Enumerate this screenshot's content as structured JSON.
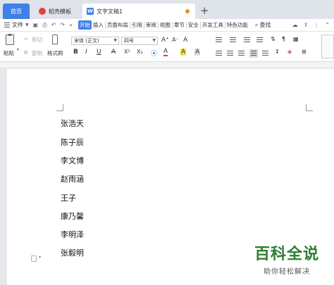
{
  "tabs": {
    "home": "首页",
    "template": "稻壳模板",
    "document": "文字文稿1",
    "add": "+"
  },
  "menu": {
    "file": "文件",
    "items": [
      "开始",
      "插入",
      "页面布局",
      "引用",
      "审阅",
      "视图",
      "章节",
      "安全",
      "开发工具",
      "特色功能"
    ],
    "active_index": 0,
    "search": "查找"
  },
  "ribbon": {
    "paste": "粘贴",
    "cut": "剪切",
    "copy": "复制",
    "format_painter": "格式刷",
    "font_name": "宋体 (正文)",
    "font_size": "四号",
    "bold": "B",
    "italic": "I",
    "underline": "U",
    "strike": "A",
    "superscript": "X²",
    "subscript": "X₂",
    "font_color": "A",
    "highlight": "A",
    "char_shade": "A",
    "grow_font": "A⁺",
    "shrink_font": "A⁻",
    "clear_format": "A"
  },
  "document": {
    "names": [
      "张浩天",
      "陈子辰",
      "李文博",
      "赵雨涵",
      "王子",
      "康乃馨",
      "李明泽",
      "张毅明"
    ]
  },
  "watermark": {
    "title": "百科全说",
    "subtitle": "助你轻松解决"
  },
  "colors": {
    "accent": "#3f80ea",
    "watermark_green": "#2e7d32",
    "font_color_red": "#e53935"
  }
}
